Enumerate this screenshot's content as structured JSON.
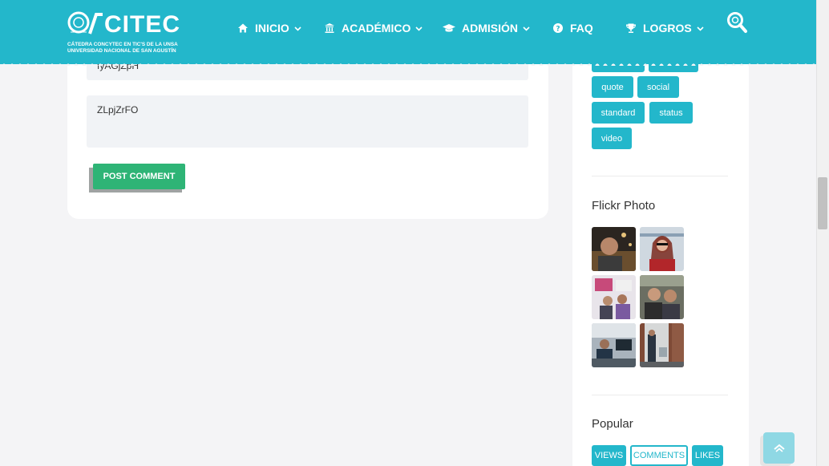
{
  "header": {
    "logo": {
      "word": "CITEC",
      "subtitle_line1": "CÁTEDRA CONCYTEC EN TIC'S DE LA UNSA",
      "subtitle_line2": "UNIVERSIDAD NACIONAL DE SAN AGUSTÍN"
    },
    "nav": [
      {
        "label": "INICIO",
        "icon": "home-icon",
        "has_dropdown": true
      },
      {
        "label": "ACADÉMICO",
        "icon": "university-icon",
        "has_dropdown": true
      },
      {
        "label": "ADMISIÓN",
        "icon": "graduation-cap-icon",
        "has_dropdown": true
      },
      {
        "label": "FAQ",
        "icon": "question-circle-icon",
        "has_dropdown": false
      },
      {
        "label": "LOGROS",
        "icon": "trophy-icon",
        "has_dropdown": true
      }
    ],
    "search_icon": "search-icon"
  },
  "comment_form": {
    "field1_value": "fyAGjZpH",
    "field2_value": "ZLpjZrFO",
    "submit_label": "POST COMMENT"
  },
  "sidebar": {
    "tags": [
      "quote",
      "social",
      "standard",
      "status",
      "video"
    ],
    "flickr_title": "Flickr Photo",
    "popular_title": "Popular",
    "popular_tabs": [
      {
        "label": "VIEWS",
        "active": false
      },
      {
        "label": "COMMENTS",
        "active": true
      },
      {
        "label": "LIKES",
        "active": false
      }
    ]
  },
  "back_to_top_icon": "chevron-up-icon",
  "colors": {
    "brand": "#23b7cb",
    "submit": "#2eb476",
    "background": "#f4f4f6"
  }
}
